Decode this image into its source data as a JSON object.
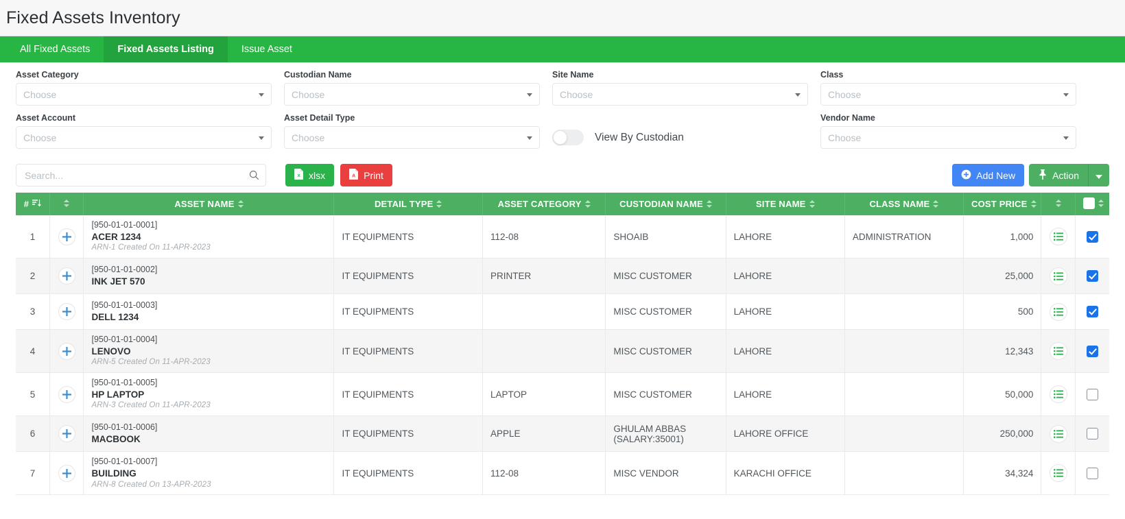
{
  "header": {
    "title": "Fixed Assets Inventory"
  },
  "tabs": [
    {
      "label": "All Fixed Assets",
      "active": false
    },
    {
      "label": "Fixed Assets Listing",
      "active": true
    },
    {
      "label": "Issue Asset",
      "active": false
    }
  ],
  "filters": {
    "placeholder": "Choose",
    "asset_category": {
      "label": "Asset Category",
      "value": ""
    },
    "custodian_name": {
      "label": "Custodian Name",
      "value": ""
    },
    "site_name": {
      "label": "Site Name",
      "value": ""
    },
    "class": {
      "label": "Class",
      "value": ""
    },
    "asset_account": {
      "label": "Asset Account",
      "value": ""
    },
    "asset_detail_type": {
      "label": "Asset Detail Type",
      "value": ""
    },
    "vendor_name": {
      "label": "Vendor Name",
      "value": ""
    },
    "view_by_custodian": {
      "label": "View By Custodian",
      "on": false
    }
  },
  "toolbar": {
    "search_placeholder": "Search...",
    "search_value": "",
    "xlsx_label": "xlsx",
    "print_label": "Print",
    "add_new_label": "Add New",
    "action_label": "Action"
  },
  "table": {
    "columns": [
      "#",
      "",
      "ASSET NAME",
      "DETAIL TYPE",
      "ASSET CATEGORY",
      "CUSTODIAN NAME",
      "SITE NAME",
      "CLASS NAME",
      "COST PRICE",
      "",
      ""
    ],
    "rows": [
      {
        "index": "1",
        "code": "[950-01-01-0001]",
        "name": "ACER 1234",
        "arn": "ARN-1 Created On 11-APR-2023",
        "detail_type": "IT EQUIPMENTS",
        "asset_category": "112-08",
        "custodian_name": "SHOAIB",
        "site_name": "LAHORE",
        "class_name": "ADMINISTRATION",
        "cost_price": "1,000",
        "checked": true
      },
      {
        "index": "2",
        "code": "[950-01-01-0002]",
        "name": "INK JET 570",
        "arn": "",
        "detail_type": "IT EQUIPMENTS",
        "asset_category": "PRINTER",
        "custodian_name": "MISC CUSTOMER",
        "site_name": "LAHORE",
        "class_name": "",
        "cost_price": "25,000",
        "checked": true
      },
      {
        "index": "3",
        "code": "[950-01-01-0003]",
        "name": "DELL 1234",
        "arn": "",
        "detail_type": "IT EQUIPMENTS",
        "asset_category": "",
        "custodian_name": "MISC CUSTOMER",
        "site_name": "LAHORE",
        "class_name": "",
        "cost_price": "500",
        "checked": true
      },
      {
        "index": "4",
        "code": "[950-01-01-0004]",
        "name": "LENOVO",
        "arn": "ARN-5 Created On 11-APR-2023",
        "detail_type": "IT EQUIPMENTS",
        "asset_category": "",
        "custodian_name": "MISC CUSTOMER",
        "site_name": "LAHORE",
        "class_name": "",
        "cost_price": "12,343",
        "checked": true
      },
      {
        "index": "5",
        "code": "[950-01-01-0005]",
        "name": "HP LAPTOP",
        "arn": "ARN-3 Created On 11-APR-2023",
        "detail_type": "IT EQUIPMENTS",
        "asset_category": "LAPTOP",
        "custodian_name": "MISC CUSTOMER",
        "site_name": "LAHORE",
        "class_name": "",
        "cost_price": "50,000",
        "checked": false
      },
      {
        "index": "6",
        "code": "[950-01-01-0006]",
        "name": "MACBOOK",
        "arn": "",
        "detail_type": "IT EQUIPMENTS",
        "asset_category": "APPLE",
        "custodian_name": "GHULAM ABBAS\n(SALARY:35001)",
        "site_name": "LAHORE OFFICE",
        "class_name": "",
        "cost_price": "250,000",
        "checked": false
      },
      {
        "index": "7",
        "code": "[950-01-01-0007]",
        "name": "BUILDING",
        "arn": "ARN-8 Created On 13-APR-2023",
        "detail_type": "IT EQUIPMENTS",
        "asset_category": "112-08",
        "custodian_name": "MISC VENDOR",
        "site_name": "KARACHI OFFICE",
        "class_name": "",
        "cost_price": "34,324",
        "checked": false
      }
    ]
  },
  "colors": {
    "tab_bar_green": "#27b644",
    "tab_active_green": "#22a33d",
    "table_header_green": "#4caf62",
    "xlsx_green": "#2bb34b",
    "print_red": "#ea3f3f",
    "add_new_blue": "#4285f4",
    "checkbox_blue": "#1a73e8"
  }
}
